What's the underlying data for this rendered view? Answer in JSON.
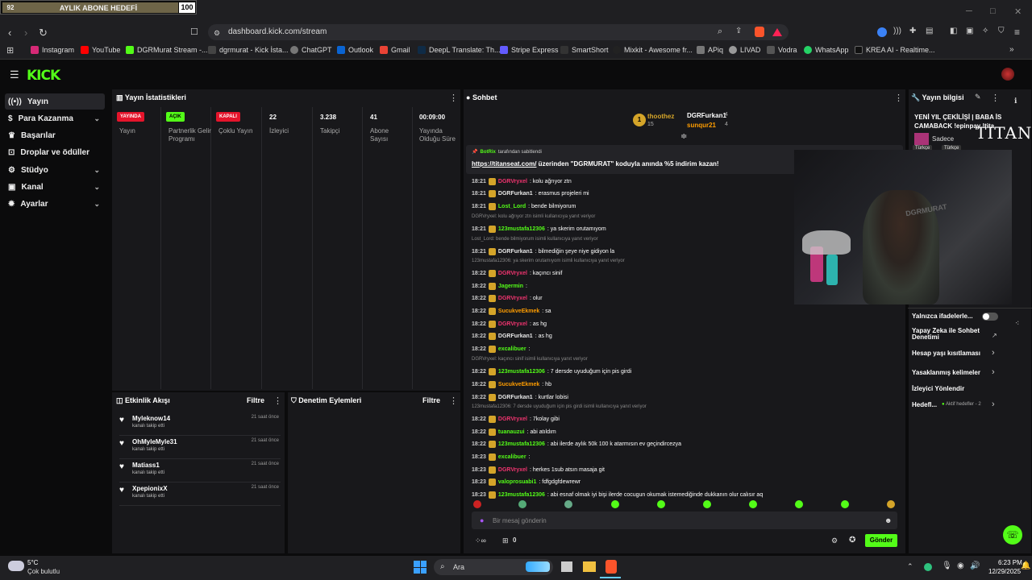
{
  "overlay": {
    "left": "92",
    "text": "AYLIK ABONE HEDEFİ",
    "count": "100"
  },
  "browser": {
    "url": "dashboard.kick.com/stream"
  },
  "bookmarks": [
    "Instagram",
    "YouTube",
    "DGRMurat Stream -...",
    "dgrmurat - Kick İsta...",
    "ChatGPT",
    "Outlook",
    "Gmail",
    "DeepL Translate: Th...",
    "Stripe Express",
    "SmartShort",
    "Mixkit - Awesome fr...",
    "APiq",
    "LIVAD",
    "Vodra",
    "WhatsApp",
    "KREA AI - Realtime..."
  ],
  "sidebar": {
    "items": [
      "Yayın",
      "Para Kazanma",
      "Başarılar",
      "Droplar ve ödüller",
      "Stüdyo",
      "Kanal",
      "Ayarlar"
    ]
  },
  "stats": {
    "title": "Yayın İstatistikleri",
    "items": [
      {
        "value": "YAYINDA",
        "label": "Yayın"
      },
      {
        "value": "AÇIK",
        "label": "Partnerlik Gelir Programı"
      },
      {
        "value": "KAPALI",
        "label": "Çoklu Yayın"
      },
      {
        "value": "22",
        "label": "İzleyici"
      },
      {
        "value": "3.238",
        "label": "Takipçi"
      },
      {
        "value": "41",
        "label": "Abone Sayısı"
      },
      {
        "value": "00:09:00",
        "label": "Yayında Olduğu Süre"
      }
    ]
  },
  "activity": {
    "title": "Etkinlik Akışı",
    "filter": "Filtre",
    "items": [
      {
        "name": "Myleknow14",
        "sub": "kanalı takip etti",
        "time": "21 saat önce"
      },
      {
        "name": "OhMyleMyle31",
        "sub": "kanalı takip etti",
        "time": "21 saat önce"
      },
      {
        "name": "Matiass1",
        "sub": "kanalı takip etti",
        "time": "21 saat önce"
      },
      {
        "name": "XpepionixX",
        "sub": "kanalı takip etti",
        "time": "21 saat önce"
      }
    ]
  },
  "moderation": {
    "title": "Denetim Eylemleri",
    "filter": "Filtre"
  },
  "chat": {
    "title": "Sohbet",
    "leaderboard": [
      {
        "name": "thoothez",
        "count": "15"
      },
      {
        "name": "DGRFurkan1",
        "count": "4"
      },
      {
        "name": "sunqur21",
        "count": "4"
      }
    ],
    "pinned_by": "BotRix",
    "pinned_suffix": "tarafından sabitlendi",
    "pinned_link": "https://titanseat.com/",
    "pinned_text": " üzerinden \"DGRMURAT\" koduyla anında %5 indirim kazan!",
    "messages": [
      {
        "time": "18:21",
        "user": "DGRVryxel",
        "color": "#f0346f",
        "text": ": kolu ağrıyor ztn"
      },
      {
        "time": "18:21",
        "user": "DGRFurkan1",
        "color": "#e8e8e8",
        "text": ": erasmus projeleri mi"
      },
      {
        "time": "18:21",
        "user": "Lost_Lord",
        "color": "#53fc18",
        "text": ": bende bilmiyorum"
      },
      {
        "reply": "DGRVryxel: kolu ağrıyor ztn isimli kullanıcıya yanıt veriyor"
      },
      {
        "time": "18:21",
        "user": "123mustafa12306",
        "color": "#53fc18",
        "text": ": ya skerim orutamıyom"
      },
      {
        "reply": "Lost_Lord: bende bilmiyorum isimli kullanıcıya yanıt veriyor"
      },
      {
        "time": "18:21",
        "user": "DGRFurkan1",
        "color": "#e8e8e8",
        "text": ": bilmediğin şeye niye gidiyon la"
      },
      {
        "reply": "123mustafa12306: ya skerim orutamıyom isimli kullanıcıya yanıt veriyor"
      },
      {
        "time": "18:22",
        "user": "DGRVryxel",
        "color": "#f0346f",
        "text": ": kaçıncı sinif"
      },
      {
        "time": "18:22",
        "user": "Jagermin",
        "color": "#53fc18",
        "text": ":"
      },
      {
        "time": "18:22",
        "user": "DGRVryxel",
        "color": "#f0346f",
        "text": ": olur"
      },
      {
        "time": "18:22",
        "user": "SucukveEkmek",
        "color": "#ff9d00",
        "text": ": sa"
      },
      {
        "time": "18:22",
        "user": "DGRVryxel",
        "color": "#f0346f",
        "text": ": as hg"
      },
      {
        "time": "18:22",
        "user": "DGRFurkan1",
        "color": "#e8e8e8",
        "text": ": as hg"
      },
      {
        "time": "18:22",
        "user": "excalibuer",
        "color": "#53fc18",
        "text": ":"
      },
      {
        "reply": "DGRVryxel: kaçıncı sinif isimli kullanıcıya yanıt veriyor"
      },
      {
        "time": "18:22",
        "user": "123mustafa12306",
        "color": "#53fc18",
        "text": ": 7 dersde uyuduğum için pis girdi"
      },
      {
        "time": "18:22",
        "user": "SucukveEkmek",
        "color": "#ff9d00",
        "text": ": hb"
      },
      {
        "time": "18:22",
        "user": "DGRFurkan1",
        "color": "#e8e8e8",
        "text": ": kurtlar lobisi"
      },
      {
        "reply": "123mustafa12306: 7 dersde uyuduğum için pis girdi isimli kullanıcıya yanıt veriyor"
      },
      {
        "time": "18:22",
        "user": "DGRVryxel",
        "color": "#f0346f",
        "text": ": 7kolay gibi"
      },
      {
        "time": "18:22",
        "user": "tuanauzui",
        "color": "#53fc18",
        "text": ": abi atıldım"
      },
      {
        "time": "18:22",
        "user": "123mustafa12306",
        "color": "#53fc18",
        "text": ": abi ilerde aylık 50k 100 k atarmısın ev geçindircezya"
      },
      {
        "time": "18:23",
        "user": "excalibuer",
        "color": "#53fc18",
        "text": ":"
      },
      {
        "time": "18:23",
        "user": "DGRVryxel",
        "color": "#f0346f",
        "text": ": herkes 1sub atsın masaja git"
      },
      {
        "time": "18:23",
        "user": "valoprosuabi1",
        "color": "#53fc18",
        "text": ": fdfgdgfdewrewr"
      },
      {
        "time": "18:23",
        "user": "123mustafa12306",
        "color": "#53fc18",
        "text": ": abi esnaf olmak iyi bişi ilerde cocugun okumak istemediğinde dukkanın olur calısır aq"
      }
    ],
    "input_placeholder": "Bir mesaj gönderin",
    "points": "0",
    "send": "Gönder"
  },
  "stream_info": {
    "title": "Yayın bilgisi",
    "stream_title": "YENİ YIL ÇEKİLİŞİ | BABA İS CAMABACK !epinpay !tita",
    "category_prefix": "Sadece",
    "tags": [
      "Türkçe",
      "Türkçe"
    ],
    "titan": "TITAN"
  },
  "right_links": [
    "Yalnızca ifadelerle...",
    "Yapay Zeka ile Sohbet Denetimi",
    "Hesap yaşı kısıtlaması",
    "Yasaklanmış kelimeler",
    "İzleyici Yönlendir",
    "Hedefl..."
  ],
  "goals_text": "Aktif hedefler - 2",
  "taskbar": {
    "temp": "5°C",
    "weather": "Çok bulutlu",
    "search": "Ara",
    "time": "6:23 PM",
    "date": "12/29/2025"
  },
  "colors": {
    "kick_green": "#53fc18",
    "live_red": "#e5142b"
  }
}
